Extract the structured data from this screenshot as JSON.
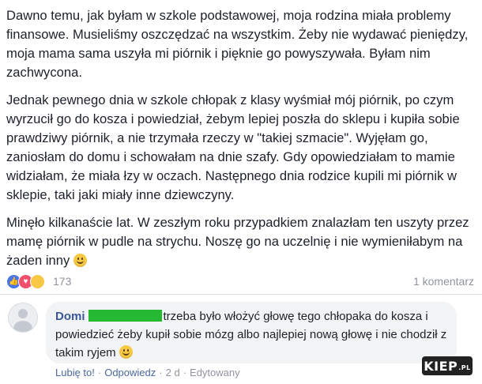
{
  "post": {
    "paragraph1": "Dawno temu, jak byłam w szkole podstawowej, moja rodzina miała problemy finansowe. Musieliśmy oszczędzać na wszystkim. Żeby nie wydawać pieniędzy, moja mama sama uszyła mi piórnik i pięknie go powyszywała. Byłam nim zachwycona.",
    "paragraph2": "Jednak pewnego dnia w szkole chłopak z klasy wyśmiał mój piórnik, po czym wyrzucił go do kosza i powiedział, żebym lepiej poszła do sklepu i kupiła sobie prawdziwy piórnik, a nie trzymała rzeczy w \"takiej szmacie\". Wyjęłam go, zaniosłam do domu i schowałam na dnie szafy. Gdy opowiedziałam to mamie widziałam, że miała łzy w oczach. Następnego dnia rodzice kupili mi piórnik w sklepie, taki jaki miały inne dziewczyny.",
    "paragraph3": "Minęło kilkanaście lat. W zeszłym roku przypadkiem znalazłam ten uszyty przez mamę piórnik w pudle na strychu. Noszę go na uczelnię i nie wymieniłabym na żaden inny",
    "emoji": "smile-emoji"
  },
  "stats": {
    "reaction_icons": [
      "like-icon",
      "love-icon",
      "sad-icon"
    ],
    "reaction_count": "173",
    "comments": "1 komentarz"
  },
  "comment": {
    "author": "Domi",
    "author_redacted": true,
    "redaction_color": "#25b833",
    "text": "trzeba było włożyć głowę tego chłopaka do kosza i powiedzieć żeby kupił sobie mózg albo najlepiej nową głowę i nie chodził z takim ryjem",
    "emoji": "smile-emoji"
  },
  "actions": {
    "like": "Lubię to!",
    "reply": "Odpowiedz",
    "age": "2 d",
    "edited": "Edytowany",
    "separator": "·"
  },
  "watermark": {
    "main": "KIEP",
    "suffix": ".PL"
  },
  "colors": {
    "link": "#385898",
    "muted": "#90949c",
    "bubble": "#f2f3f5"
  }
}
